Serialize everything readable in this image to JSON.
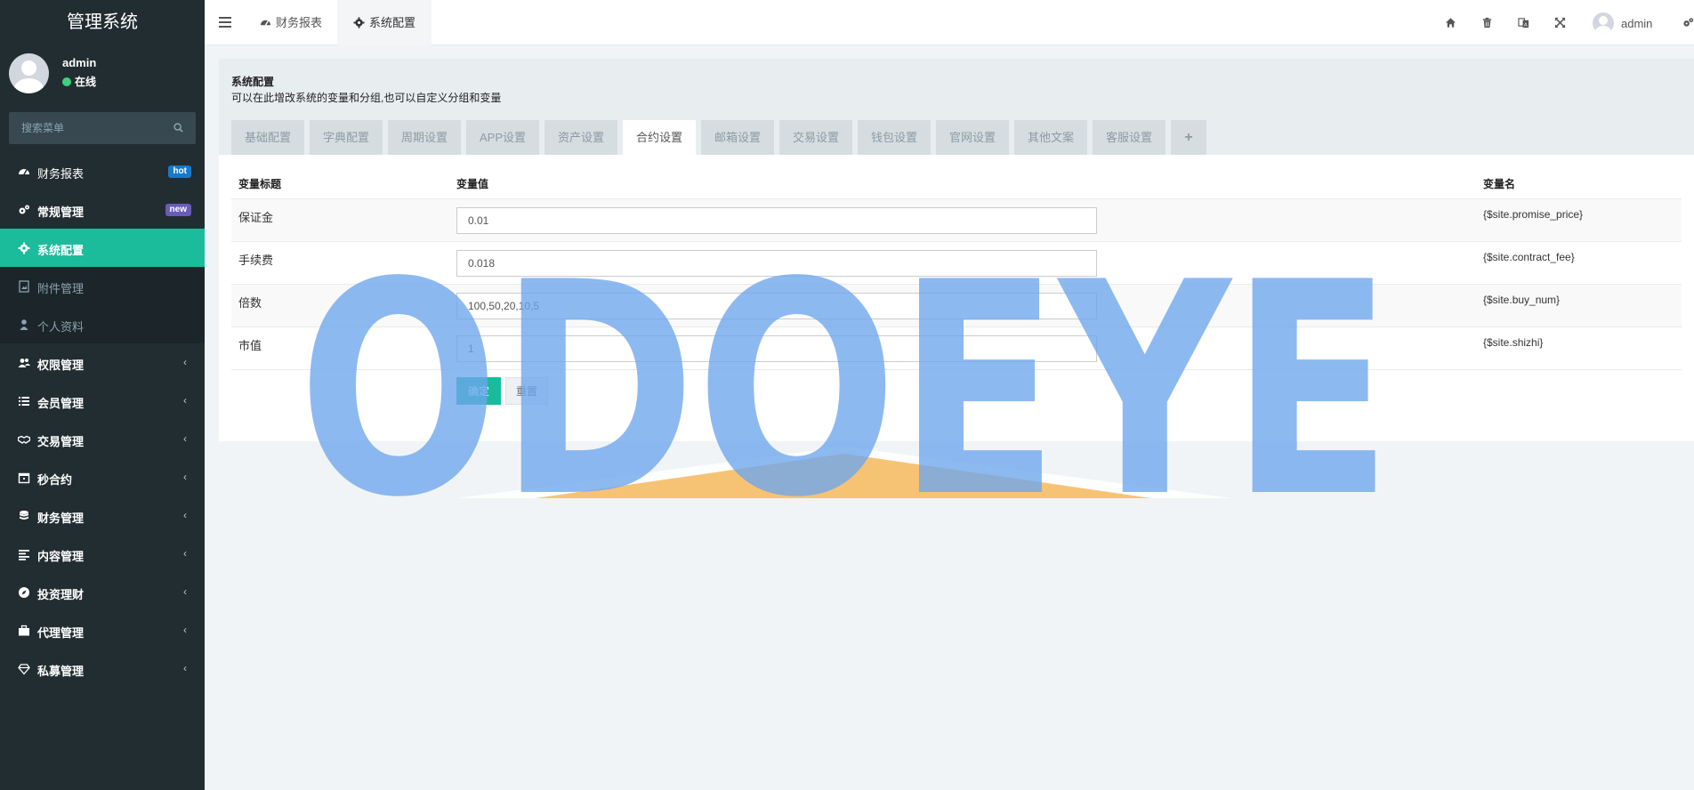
{
  "app": {
    "title": "管理系统"
  },
  "user": {
    "name": "admin",
    "status": "在线"
  },
  "search": {
    "placeholder": "搜索菜单"
  },
  "sidebar": {
    "items": [
      {
        "label": "财务报表",
        "badge": "hot"
      },
      {
        "label": "常规管理",
        "badge": "new"
      },
      {
        "label": "系统配置"
      },
      {
        "label": "附件管理"
      },
      {
        "label": "个人资料"
      },
      {
        "label": "权限管理"
      },
      {
        "label": "会员管理"
      },
      {
        "label": "交易管理"
      },
      {
        "label": "秒合约"
      },
      {
        "label": "财务管理"
      },
      {
        "label": "内容管理"
      },
      {
        "label": "投资理财"
      },
      {
        "label": "代理管理"
      },
      {
        "label": "私募管理"
      }
    ],
    "arrow": "‹"
  },
  "topbar": {
    "tabs": [
      {
        "label": "财务报表"
      },
      {
        "label": "系统配置"
      }
    ],
    "user": "admin"
  },
  "page": {
    "title": "系统配置",
    "description": "可以在此增改系统的变量和分组,也可以自定义分组和变量",
    "tabs": [
      "基础配置",
      "字典配置",
      "周期设置",
      "APP设置",
      "资产设置",
      "合约设置",
      "邮箱设置",
      "交易设置",
      "钱包设置",
      "官网设置",
      "其他文案",
      "客服设置",
      "+"
    ],
    "active_tab": "合约设置"
  },
  "table": {
    "headers": {
      "title": "变量标题",
      "value": "变量值",
      "name": "变量名"
    },
    "rows": [
      {
        "title": "保证金",
        "value": "0.01",
        "name": "{$site.promise_price}"
      },
      {
        "title": "手续费",
        "value": "0.018",
        "name": "{$site.contract_fee}"
      },
      {
        "title": "倍数",
        "value": "100,50,20,10,5",
        "name": "{$site.buy_num}"
      },
      {
        "title": "市值",
        "value": "1",
        "name": "{$site.shizhi}"
      }
    ]
  },
  "buttons": {
    "submit": "确定",
    "reset": "重置"
  },
  "watermark": {
    "text": "ODOEYE"
  },
  "colors": {
    "sidebar_bg": "#222d32",
    "accent": "#18bc9c",
    "badge_hot": "#1979c7",
    "badge_new": "#6a5bb8",
    "watermark_blue": "#6ea6ee",
    "watermark_orange": "#f5c06e"
  }
}
